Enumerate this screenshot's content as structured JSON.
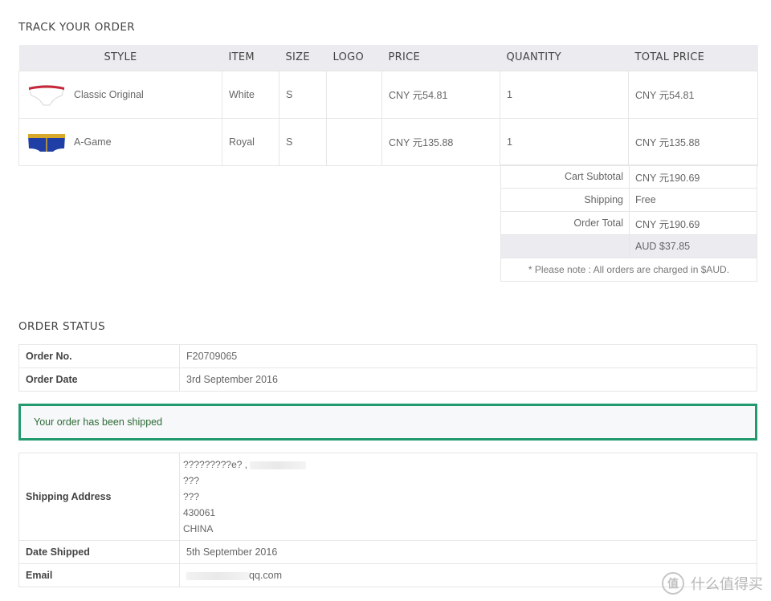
{
  "track": {
    "title": "TRACK YOUR ORDER",
    "columns": [
      "STYLE",
      "ITEM",
      "SIZE",
      "LOGO",
      "PRICE",
      "QUANTITY",
      "TOTAL PRICE"
    ],
    "rows": [
      {
        "style": "Classic Original",
        "item": "White",
        "size": "S",
        "logo": "",
        "price": "CNY 元54.81",
        "quantity": "1",
        "total": "CNY 元54.81",
        "thumb_color": "#ffffff",
        "thumb_band": "#c8273a"
      },
      {
        "style": "A-Game",
        "item": "Royal",
        "size": "S",
        "logo": "",
        "price": "CNY 元135.88",
        "quantity": "1",
        "total": "CNY 元135.88",
        "thumb_color": "#1f3fa6",
        "thumb_band": "#d7a82a"
      }
    ],
    "totals": {
      "cart_subtotal_label": "Cart Subtotal",
      "cart_subtotal": "CNY 元190.69",
      "shipping_label": "Shipping",
      "shipping": "Free",
      "order_total_label": "Order Total",
      "order_total": "CNY 元190.69",
      "aud_total": "AUD $37.85",
      "note": "* Please note : All orders are charged in $AUD."
    }
  },
  "status": {
    "title": "ORDER STATUS",
    "order_no_label": "Order No.",
    "order_no": "F20709065",
    "order_date_label": "Order Date",
    "order_date": "3rd September 2016",
    "shipped_message": "Your order has been shipped",
    "shipping_address_label": "Shipping Address",
    "address_lines": [
      "?????????e? ,",
      "???",
      "???",
      "430061",
      "CHINA"
    ],
    "date_shipped_label": "Date Shipped",
    "date_shipped": "5th September 2016",
    "email_label": "Email",
    "email_visible": "qq.com"
  },
  "watermark": {
    "text": "什么值得买",
    "logo_glyph": "值"
  }
}
